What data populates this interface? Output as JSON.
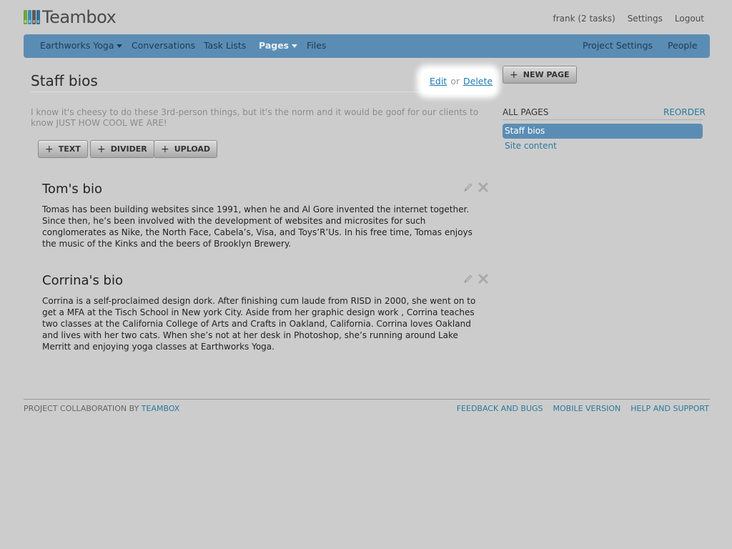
{
  "app": {
    "name": "Teambox",
    "logo_colors": [
      "#6fa43a",
      "#3a8fb5",
      "#5a5a5a",
      "#2e6f96"
    ]
  },
  "topnav": {
    "user": "frank (2 tasks)",
    "settings": "Settings",
    "logout": "Logout"
  },
  "navbar": {
    "project": "Earthworks Yoga",
    "conversations": "Conversations",
    "task_lists": "Task Lists",
    "pages": "Pages",
    "files": "Files",
    "project_settings": "Project Settings",
    "people": "People",
    "color": "#5b8db4"
  },
  "page": {
    "title": "Staff bios",
    "edit": "Edit",
    "or": "or",
    "delete": "Delete",
    "intro": "I know it's cheesy to do these 3rd-person things, but it's the norm and it would be goof for our clients to know JUST HOW COOL WE ARE!"
  },
  "toolbar": {
    "text": "TEXT",
    "divider": "DIVIDER",
    "upload": "UPLOAD",
    "new_page": "NEW PAGE"
  },
  "bios": [
    {
      "title": "Tom's bio",
      "text": "Tomas has been building websites since 1991, when he and Al Gore invented the internet together. Since then, he’s been involved with the development of websites and microsites for such conglomerates as Nike, the North Face, Cabela’s, Visa, and Toys’R’Us. In his free time, Tomas enjoys the music of the Kinks and the beers of Brooklyn Brewery."
    },
    {
      "title": "Corrina's bio",
      "text": "Corrina is a self-proclaimed design dork. After finishing cum laude from RISD in 2000, she went on to get a MFA at the Tisch School in New york City. Aside from her graphic design work , Corrina teaches two classes at the California College of Arts and Crafts in Oakland, California. Corrina loves Oakland and lives with her two cats. When she’s not at her desk in Photoshop, she’s running around Lake Merritt and enjoying yoga classes at Earthworks Yoga."
    }
  ],
  "sidebar": {
    "heading": "ALL PAGES",
    "reorder": "REORDER",
    "items": [
      "Staff bios",
      "Site content"
    ]
  },
  "footer": {
    "left_prefix": "PROJECT COLLABORATION BY",
    "brand": "TEAMBOX",
    "feedback": "FEEDBACK AND BUGS",
    "mobile": "MOBILE VERSION",
    "help": "HELP AND SUPPORT"
  }
}
